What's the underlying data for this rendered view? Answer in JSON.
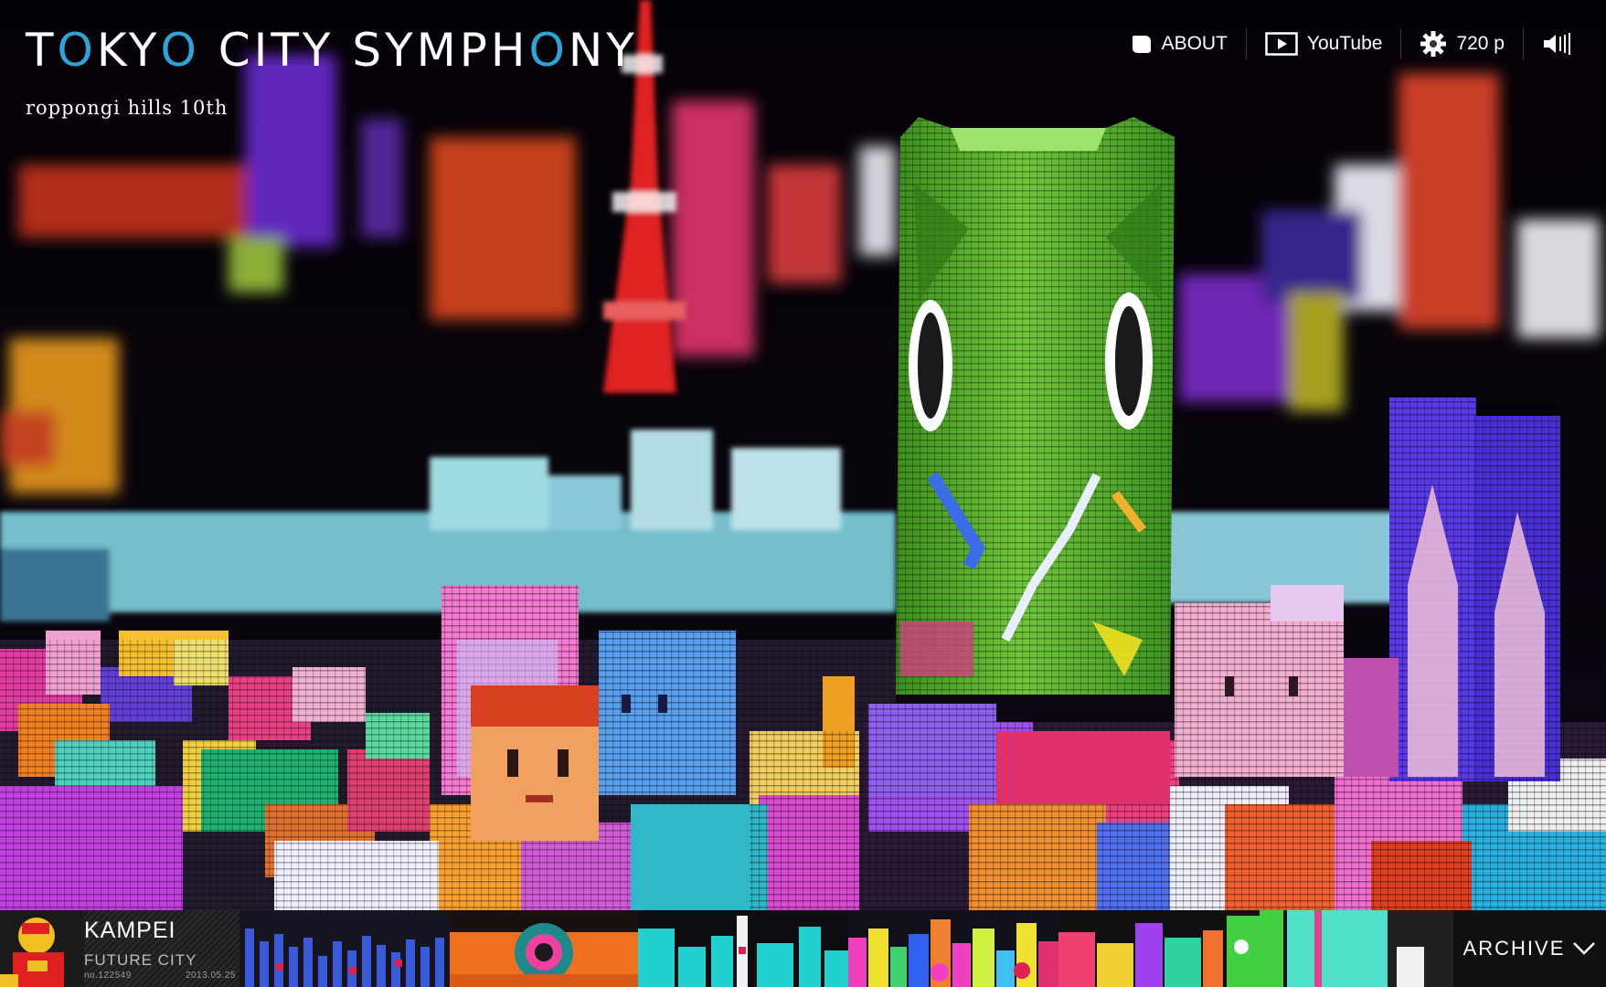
{
  "header": {
    "title_parts": [
      "T",
      "O",
      "KY",
      "O",
      " CITY SYMPH",
      "O",
      "NY"
    ],
    "subtitle": "roppongi hills 10th"
  },
  "nav": {
    "about_label": "ABOUT",
    "youtube_label": "YouTube",
    "quality_label": "720 p"
  },
  "now_playing": {
    "title": "KAMPEI",
    "category": "FUTURE CITY",
    "number": "no.122549",
    "date": "2013.05.25"
  },
  "archive": {
    "label": "ARCHIVE"
  },
  "colors": {
    "accent": "#2aa7d8",
    "tower": "#58b531",
    "bar": "#0c0c0c"
  },
  "icons": [
    "speech-bubble-icon",
    "play-icon",
    "gear-icon",
    "volume-icon",
    "chevron-down-icon"
  ]
}
